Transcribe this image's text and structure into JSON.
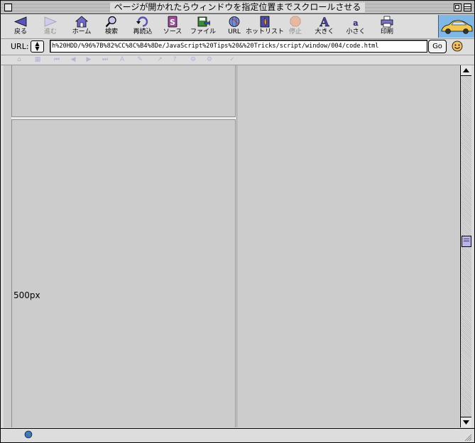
{
  "window": {
    "title": "ページが開かれたらウィンドウを指定位置までスクロールさせる"
  },
  "toolbar": {
    "items": [
      {
        "label": "戻る",
        "icon": "back-arrow-icon",
        "enabled": true
      },
      {
        "label": "進む",
        "icon": "forward-arrow-icon",
        "enabled": false
      },
      {
        "label": "ホーム",
        "icon": "home-icon",
        "enabled": true
      },
      {
        "label": "検索",
        "icon": "search-icon",
        "enabled": true
      },
      {
        "label": "再読込",
        "icon": "reload-icon",
        "enabled": true
      },
      {
        "label": "ソース",
        "icon": "source-icon",
        "enabled": true
      },
      {
        "label": "ファイル",
        "icon": "file-icon",
        "enabled": true
      },
      {
        "label": "URL",
        "icon": "url-globe-icon",
        "enabled": true
      },
      {
        "label": "ホットリスト",
        "icon": "hotlist-icon",
        "enabled": true
      },
      {
        "label": "停止",
        "icon": "stop-icon",
        "enabled": false
      },
      {
        "label": "大きく",
        "icon": "text-bigger-icon",
        "enabled": true
      },
      {
        "label": "小さく",
        "icon": "text-smaller-icon",
        "enabled": true
      },
      {
        "label": "印刷",
        "icon": "print-icon",
        "enabled": true
      }
    ]
  },
  "urlbar": {
    "label": "URL:",
    "value": "h%20HDD/%96%7B%82%CC%8C%B4%8De/JavaScript%20Tips%20&%20Tricks/script/window/004/code.html",
    "go_label": "Go"
  },
  "content": {
    "size_label": "500px"
  },
  "colors": {
    "window_bg": "#dddddd",
    "content_bg": "#cccccc",
    "logo_bg": "#7fb7e6",
    "thumb": "#b7b3e8"
  }
}
